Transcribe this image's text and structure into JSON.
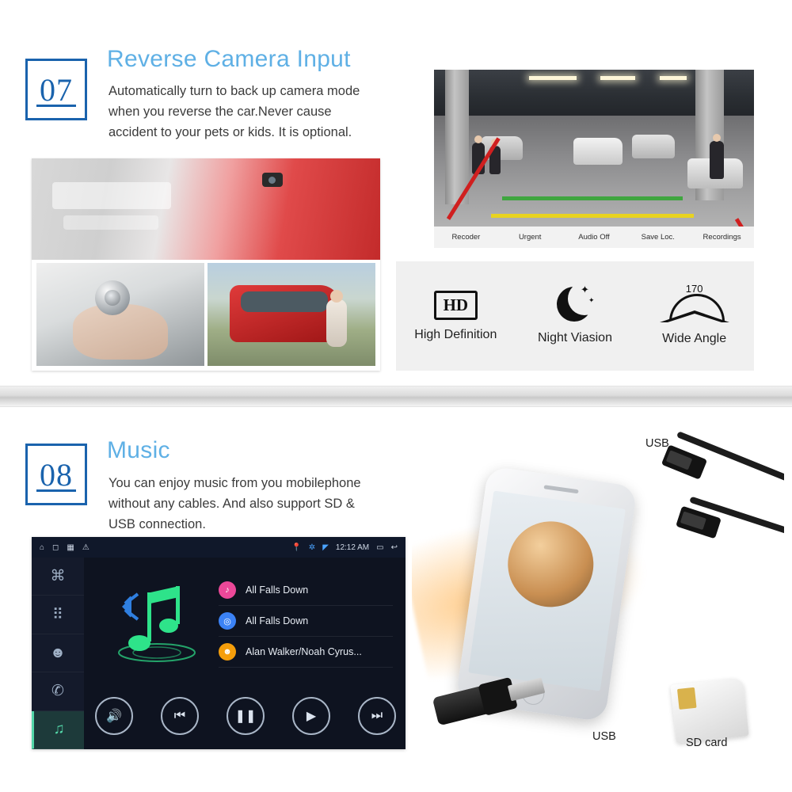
{
  "sections": [
    {
      "number": "07",
      "title": "Reverse Camera Input",
      "body": "Automatically turn to back up camera mode when you reverse the car.Never cause accident to your pets or kids. It is optional.",
      "camera_bar": [
        "Recoder",
        "Urgent",
        "Audio Off",
        "Save Loc.",
        "Recordings"
      ],
      "features": [
        {
          "icon": "hd-icon",
          "badge": "HD",
          "label": "High Definition"
        },
        {
          "icon": "moon-star-icon",
          "badge": "",
          "label": "Night Viasion"
        },
        {
          "icon": "wide-angle-icon",
          "badge": "170",
          "label": "Wide Angle"
        }
      ]
    },
    {
      "number": "08",
      "title": "Music",
      "body": "You can enjoy music from you mobilephone without any cables. And also support SD & USB connection.",
      "head_unit": {
        "status_time": "12:12 AM",
        "status_icons": [
          "home-icon",
          "back-icon",
          "apps-icon",
          "warning-icon",
          "location-icon",
          "bluetooth-icon",
          "wifi-icon",
          "window-icon",
          "return-icon"
        ],
        "sidebar": [
          {
            "icon": "link-icon",
            "active": false
          },
          {
            "icon": "apps-grid-icon",
            "active": false
          },
          {
            "icon": "contact-icon",
            "active": false
          },
          {
            "icon": "phone-icon",
            "active": false
          },
          {
            "icon": "music-note-icon",
            "active": true
          }
        ],
        "tracks": [
          {
            "icon": "music-note-icon",
            "color": "#ec4899",
            "text": "All Falls Down"
          },
          {
            "icon": "disc-icon",
            "color": "#3b82f6",
            "text": "All Falls Down"
          },
          {
            "icon": "artist-icon",
            "color": "#f59e0b",
            "text": "Alan Walker/Noah Cyrus..."
          }
        ],
        "controls": [
          {
            "icon": "volume-icon",
            "glyph": "🔊"
          },
          {
            "icon": "previous-icon",
            "glyph": "⏮"
          },
          {
            "icon": "pause-icon",
            "glyph": "❚❚"
          },
          {
            "icon": "play-icon",
            "glyph": "▶"
          },
          {
            "icon": "next-icon",
            "glyph": "⏭"
          }
        ]
      },
      "photo_labels": [
        {
          "name": "usb-top-label",
          "text": "USB"
        },
        {
          "name": "usb-bottom-label",
          "text": "USB"
        },
        {
          "name": "sd-card-label",
          "text": "SD card"
        }
      ]
    }
  ],
  "colors": {
    "number_blue": "#1a63ad",
    "title_blue": "#5fb0e5",
    "body_text": "#3b3b3b",
    "guide_green": "#3fa63f",
    "guide_yellow": "#e8d320",
    "guide_red": "#d01f1f"
  }
}
